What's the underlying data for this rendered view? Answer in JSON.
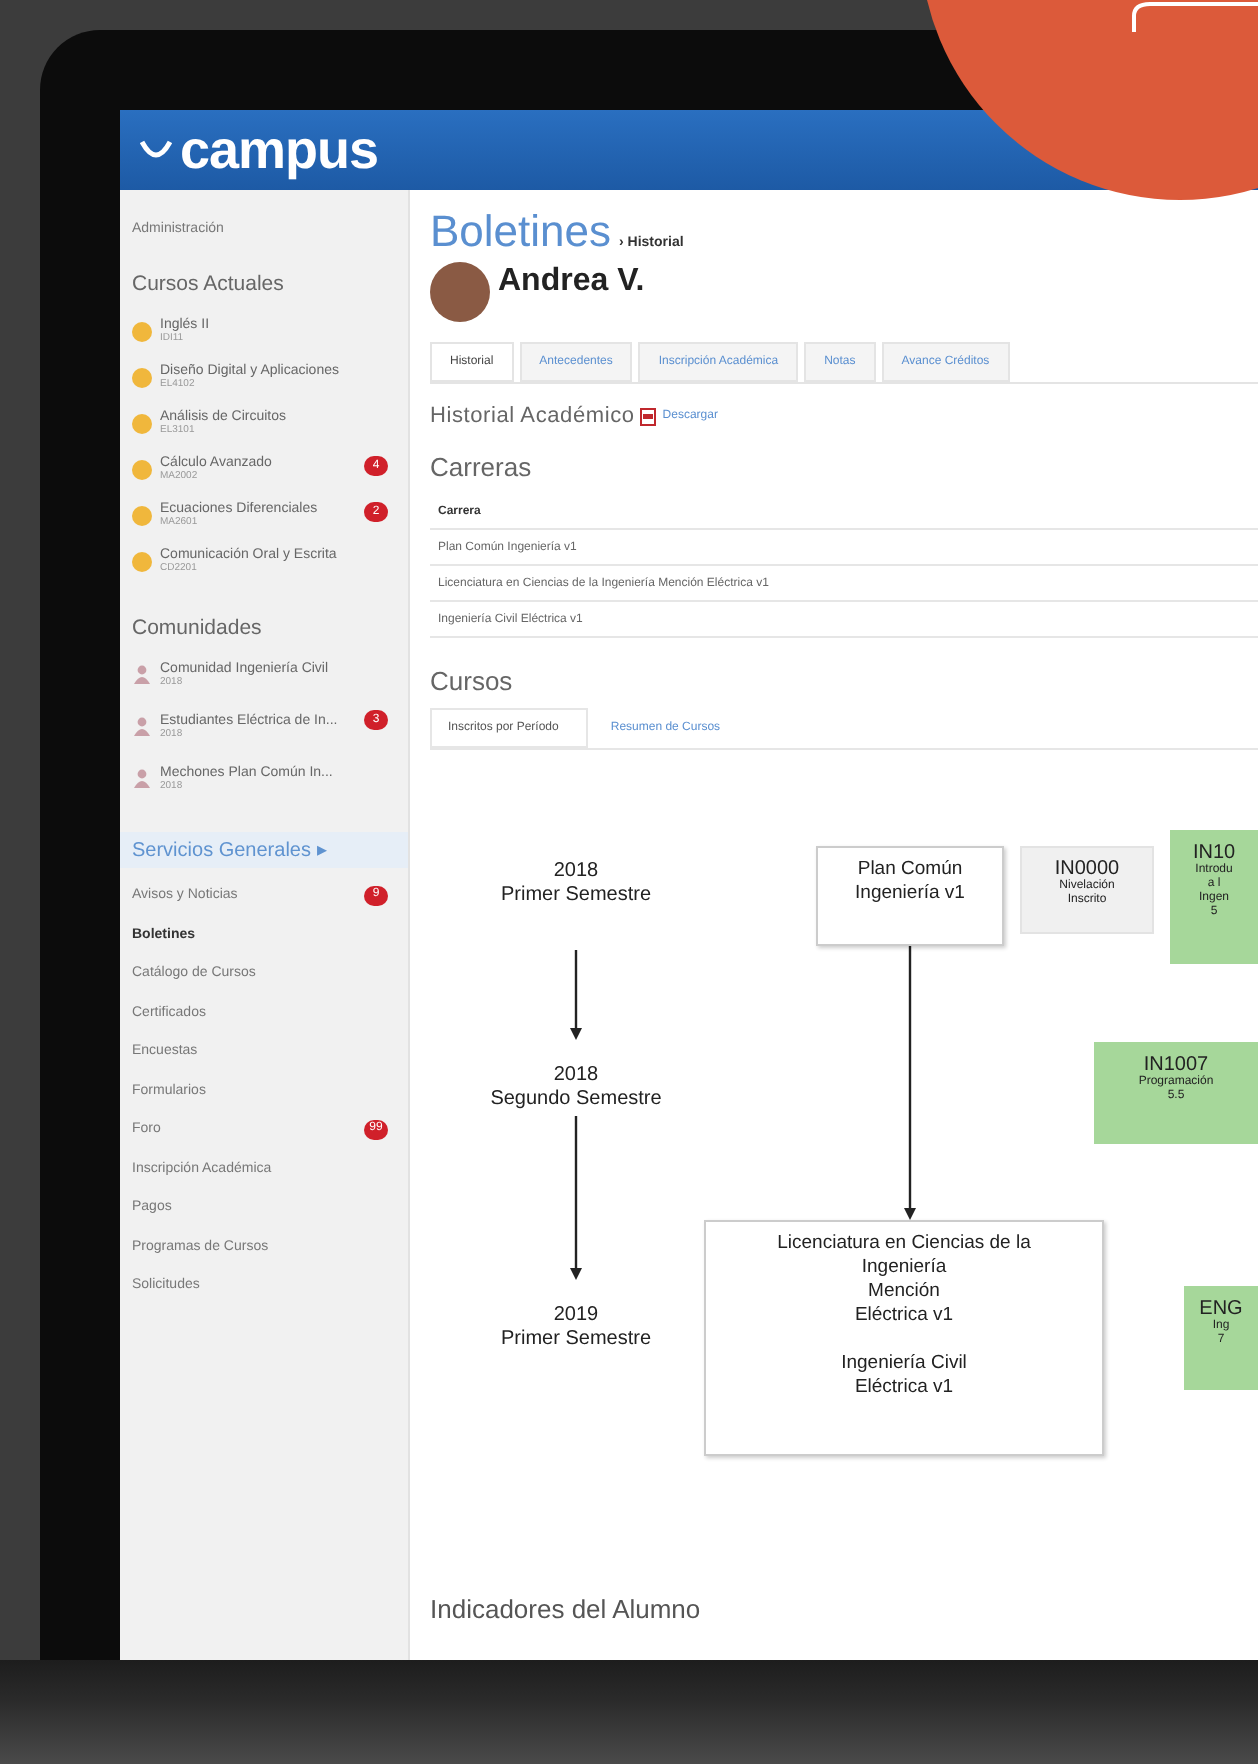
{
  "logo": "campus",
  "sidebar": {
    "admin_link": "Administración",
    "courses_title": "Cursos Actuales",
    "courses": [
      {
        "name": "Inglés II",
        "code": "IDI11"
      },
      {
        "name": "Diseño Digital y Aplicaciones",
        "code": "EL4102"
      },
      {
        "name": "Análisis de Circuitos",
        "code": "EL3101"
      },
      {
        "name": "Cálculo Avanzado",
        "code": "MA2002",
        "badge": "4"
      },
      {
        "name": "Ecuaciones Diferenciales",
        "code": "MA2601",
        "badge": "2"
      },
      {
        "name": "Comunicación Oral y Escrita",
        "code": "CD2201"
      }
    ],
    "communities_title": "Comunidades",
    "communities": [
      {
        "name": "Comunidad Ingeniería Civil",
        "year": "2018"
      },
      {
        "name": "Estudiantes Eléctrica de In...",
        "year": "2018",
        "badge": "3"
      },
      {
        "name": "Mechones Plan Común In...",
        "year": "2018"
      }
    ],
    "services_title": "Servicios Generales ▸",
    "services": [
      {
        "label": "Avisos y Noticias",
        "selected": false,
        "badge": "9"
      },
      {
        "label": "Boletines",
        "selected": true
      },
      {
        "label": "Catálogo de Cursos",
        "selected": false
      },
      {
        "label": "Certificados",
        "selected": false
      },
      {
        "label": "Encuestas",
        "selected": false
      },
      {
        "label": "Formularios",
        "selected": false
      },
      {
        "label": "Foro",
        "selected": false,
        "badge": "99"
      },
      {
        "label": "Inscripción Académica",
        "selected": false
      },
      {
        "label": "Pagos",
        "selected": false
      },
      {
        "label": "Programas de Cursos",
        "selected": false
      },
      {
        "label": "Solicitudes",
        "selected": false
      }
    ]
  },
  "page_title": "Boletines",
  "breadcrumb": "› Historial",
  "student_name": "Andrea V.",
  "tabs": [
    {
      "label": "Historial",
      "selected": true
    },
    {
      "label": "Antecedentes",
      "selected": false
    },
    {
      "label": "Inscripción Académica",
      "selected": false
    },
    {
      "label": "Notas",
      "selected": false
    },
    {
      "label": "Avance Créditos",
      "selected": false
    }
  ],
  "history_title": "Historial Académico",
  "download_link": "Descargar",
  "careers": {
    "title": "Carreras",
    "column": "Carrera",
    "rows": [
      "Plan Común Ingeniería v1",
      "Licenciatura en Ciencias de la Ingeniería Mención Eléctrica v1",
      "Ingeniería Civil Eléctrica v1"
    ]
  },
  "courses_section": {
    "title": "Cursos",
    "subtabs": [
      {
        "label": "Inscritos por Período",
        "selected": true
      },
      {
        "label": "Resumen de Cursos",
        "selected": false
      }
    ]
  },
  "semesters": [
    {
      "year": "2018",
      "term": "Primer Semestre"
    },
    {
      "year": "2018",
      "term": "Segundo Semestre"
    },
    {
      "year": "2019",
      "term": "Primer Semestre"
    }
  ],
  "nodes": [
    {
      "kind": "plan",
      "blocks": [
        [
          "Plan Común",
          "Ingeniería v1"
        ]
      ]
    },
    {
      "kind": "course",
      "approved": false,
      "code": "IN0000",
      "lines": [
        "Nivelación",
        "Inscrito"
      ]
    },
    {
      "kind": "course",
      "approved": true,
      "code": "IN10",
      "lines": [
        "Introdu",
        "a l",
        "Ingen",
        "5"
      ]
    },
    {
      "kind": "course",
      "approved": true,
      "code": "IN1007",
      "lines": [
        "Programación",
        "5.5"
      ]
    },
    {
      "kind": "plan",
      "blocks": [
        [
          "Licenciatura en Ciencias de la",
          "Ingeniería",
          "Mención",
          "Eléctrica v1"
        ],
        [
          "Ingeniería Civil",
          "Eléctrica v1"
        ]
      ]
    },
    {
      "kind": "course",
      "approved": true,
      "code": "ENG",
      "lines": [
        "Ing",
        "7"
      ]
    }
  ],
  "indicators_title": "Indicadores del Alumno"
}
